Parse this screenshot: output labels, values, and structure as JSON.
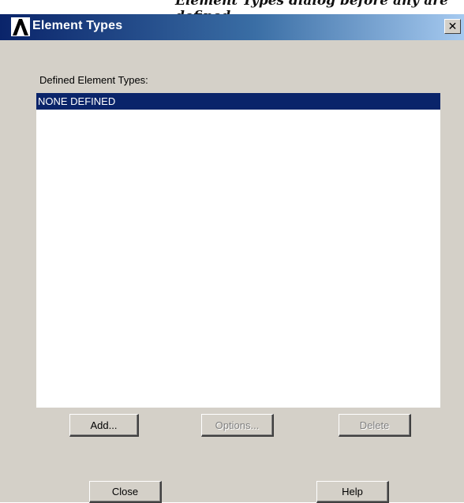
{
  "cropped_top_text": "Element Types dialog before any are defined",
  "window": {
    "title": "Element Types",
    "close_glyph": "✕",
    "logo_icon": "ansys-logo-icon"
  },
  "list": {
    "label": "Defined Element Types:",
    "items": [
      "NONE DEFINED"
    ],
    "selected_index": 0
  },
  "buttons": {
    "add": "Add...",
    "options": "Options...",
    "delete": "Delete",
    "close": "Close",
    "help": "Help"
  },
  "colors": {
    "title_bar_start": "#0a246a",
    "title_bar_end": "#a6caf0",
    "dialog_face": "#d4d0c8",
    "selection": "#0a246a"
  }
}
